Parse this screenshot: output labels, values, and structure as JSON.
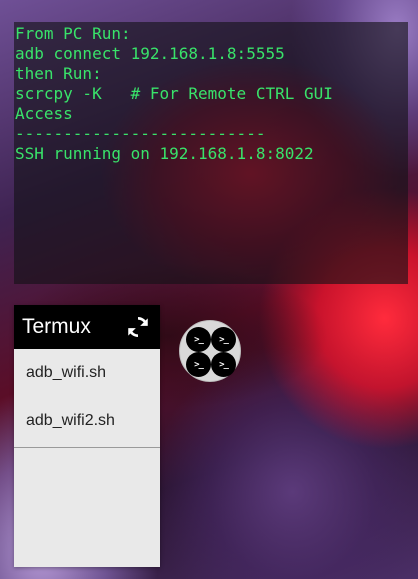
{
  "terminal": {
    "lines": [
      "From PC Run:",
      "adb connect 192.168.1.8:5555",
      "then Run:",
      "scrcpy -K   # For Remote CTRL GUI",
      "Access",
      "--------------------------",
      "SSH running on 192.168.1.8:8022"
    ],
    "text_color": "#39e36a"
  },
  "widget": {
    "title": "Termux",
    "refresh_icon": "refresh-icon",
    "scripts": [
      {
        "label": "adb_wifi.sh"
      },
      {
        "label": "adb_wifi2.sh"
      }
    ]
  },
  "floating_bubble": {
    "icon": "termux-bubble-icon",
    "prompt_glyph": ">_"
  }
}
